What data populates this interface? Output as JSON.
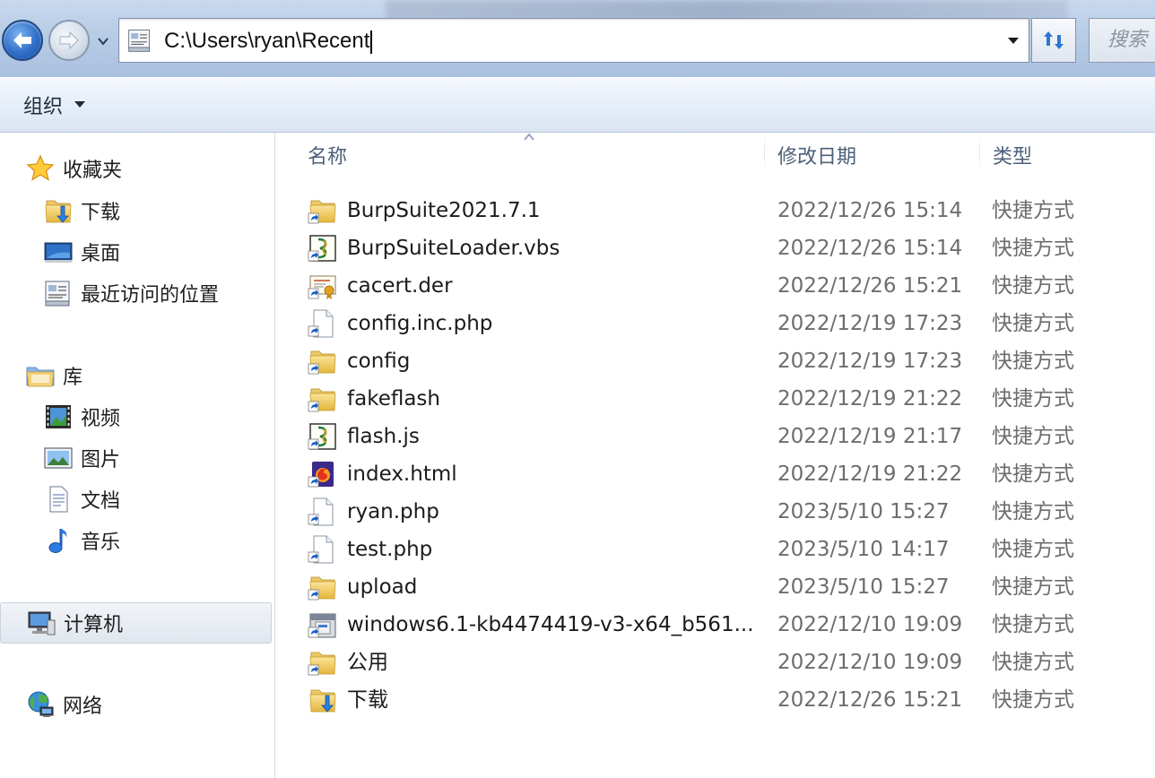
{
  "address_bar": {
    "path": "C:\\Users\\ryan\\Recent",
    "icon": "recent-places-icon"
  },
  "search": {
    "placeholder": "搜索"
  },
  "toolbar": {
    "organize_label": "组织"
  },
  "navigation": {
    "favorites": {
      "label": "收藏夹",
      "items": [
        {
          "label": "下载",
          "icon": "downloads-folder-icon"
        },
        {
          "label": "桌面",
          "icon": "desktop-icon"
        },
        {
          "label": "最近访问的位置",
          "icon": "recent-places-icon"
        }
      ]
    },
    "libraries": {
      "label": "库",
      "items": [
        {
          "label": "视频",
          "icon": "video-library-icon"
        },
        {
          "label": "图片",
          "icon": "pictures-library-icon"
        },
        {
          "label": "文档",
          "icon": "documents-library-icon"
        },
        {
          "label": "音乐",
          "icon": "music-library-icon"
        }
      ]
    },
    "computer": {
      "label": "计算机",
      "selected": true
    },
    "network": {
      "label": "网络"
    }
  },
  "file_list": {
    "columns": {
      "name": "名称",
      "modified": "修改日期",
      "type": "类型"
    },
    "sort_column": "name",
    "rows": [
      {
        "name": "BurpSuite2021.7.1",
        "date": "2022/12/26 15:14",
        "type": "快捷方式",
        "icon": "folder-shortcut-icon"
      },
      {
        "name": "BurpSuiteLoader.vbs",
        "date": "2022/12/26 15:14",
        "type": "快捷方式",
        "icon": "script-file-icon"
      },
      {
        "name": "cacert.der",
        "date": "2022/12/26 15:21",
        "type": "快捷方式",
        "icon": "certificate-file-icon"
      },
      {
        "name": "config.inc.php",
        "date": "2022/12/19 17:23",
        "type": "快捷方式",
        "icon": "generic-file-icon"
      },
      {
        "name": "config",
        "date": "2022/12/19 17:23",
        "type": "快捷方式",
        "icon": "folder-shortcut-icon"
      },
      {
        "name": "fakeflash",
        "date": "2022/12/19 21:22",
        "type": "快捷方式",
        "icon": "folder-shortcut-icon"
      },
      {
        "name": "flash.js",
        "date": "2022/12/19 21:17",
        "type": "快捷方式",
        "icon": "script-file-icon"
      },
      {
        "name": "index.html",
        "date": "2022/12/19 21:22",
        "type": "快捷方式",
        "icon": "firefox-html-icon"
      },
      {
        "name": "ryan.php",
        "date": "2023/5/10 15:27",
        "type": "快捷方式",
        "icon": "generic-file-icon"
      },
      {
        "name": "test.php",
        "date": "2023/5/10 14:17",
        "type": "快捷方式",
        "icon": "generic-file-icon"
      },
      {
        "name": "upload",
        "date": "2023/5/10 15:27",
        "type": "快捷方式",
        "icon": "folder-shortcut-icon"
      },
      {
        "name": "windows6.1-kb4474419-v3-x64_b561...",
        "date": "2022/12/10 19:09",
        "type": "快捷方式",
        "icon": "installer-package-icon"
      },
      {
        "name": "公用",
        "date": "2022/12/10 19:09",
        "type": "快捷方式",
        "icon": "folder-shortcut-icon"
      },
      {
        "name": "下载",
        "date": "2022/12/26 15:21",
        "type": "快捷方式",
        "icon": "downloads-folder-icon"
      }
    ]
  }
}
